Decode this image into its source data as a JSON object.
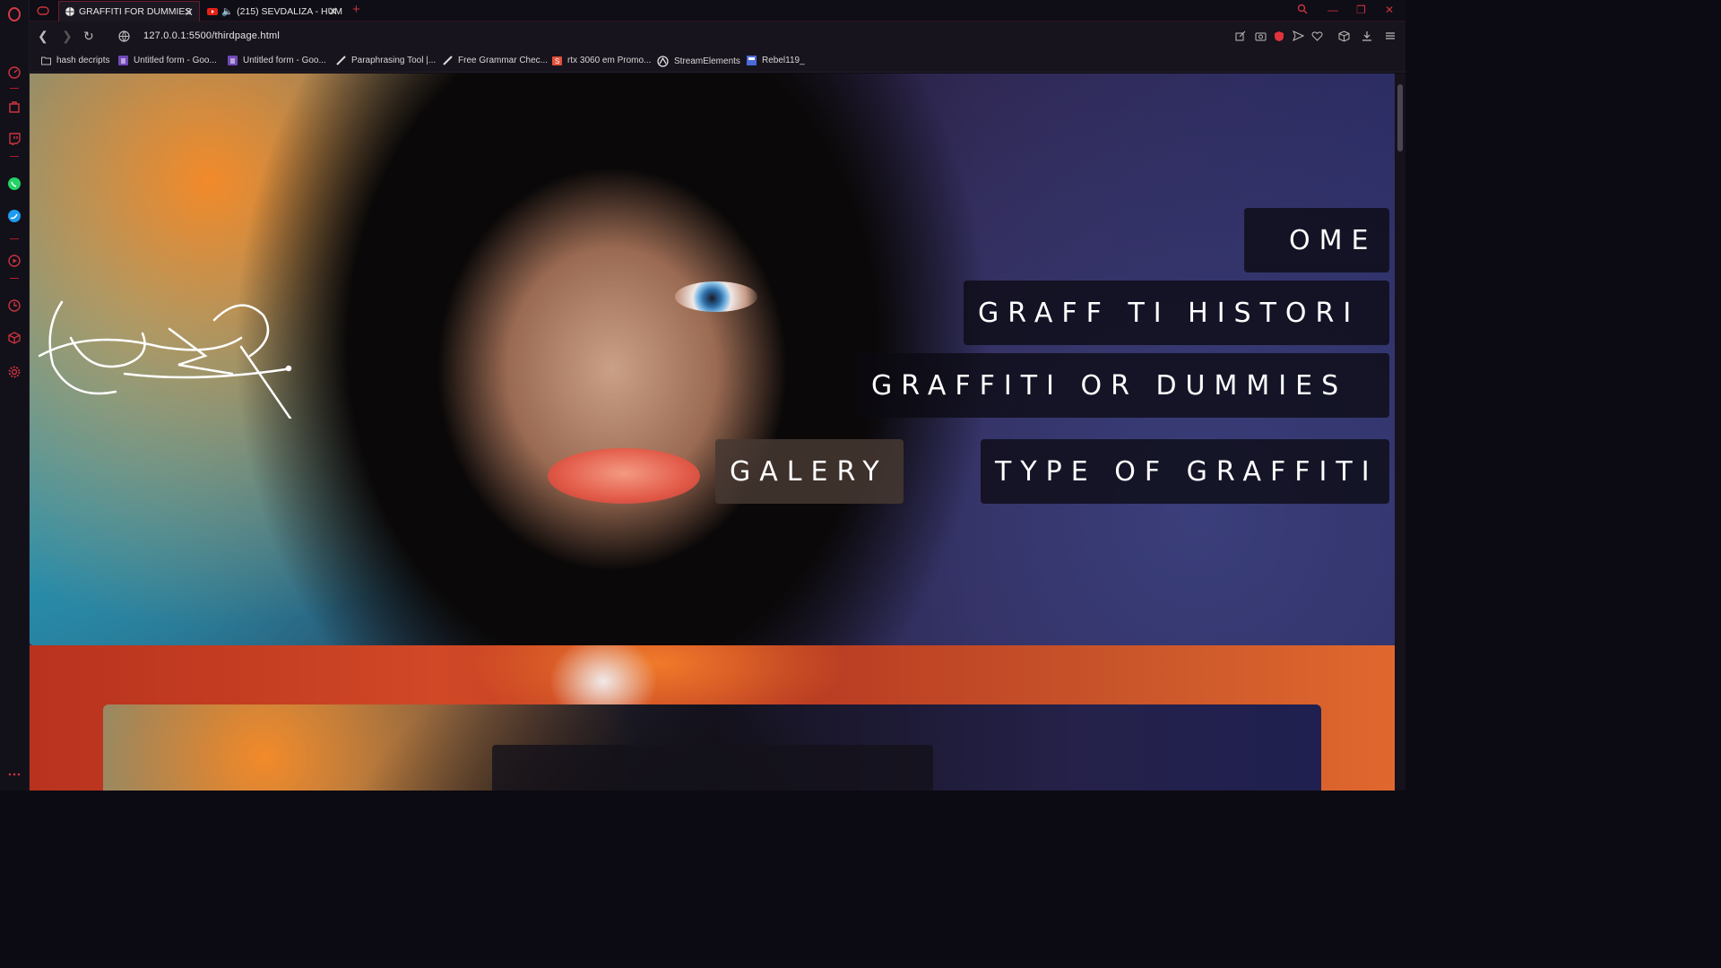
{
  "browser": {
    "tabs": [
      {
        "title": "GRAFFITI FOR DUMMIES",
        "active": true
      },
      {
        "title": "(215) SEVDALIZA - HUM",
        "active": false
      }
    ],
    "url": "127.0.0.1:5500/thirdpage.html",
    "accent": "#c9343f"
  },
  "bookmarks": [
    {
      "label": "hash decripts",
      "icon": "folder-icon"
    },
    {
      "label": "Untitled form - Goo...",
      "icon": "forms-icon"
    },
    {
      "label": "Untitled form - Goo...",
      "icon": "forms-icon"
    },
    {
      "label": "Paraphrasing Tool |...",
      "icon": "quill-icon"
    },
    {
      "label": "Free Grammar Chec...",
      "icon": "quill-icon"
    },
    {
      "label": "rtx 3060 em Promo...",
      "icon": "shop-icon"
    },
    {
      "label": "StreamElements",
      "icon": "streamelements-icon"
    },
    {
      "label": "Rebel119_",
      "icon": "page-icon"
    }
  ],
  "page": {
    "nav": {
      "home": "OME",
      "history": "GRAFF TI HISTORI",
      "dummies": "GRAFFITI  OR DUMMIES",
      "galery": "GALERY",
      "types": "TYPE OF GRAFFITI"
    }
  }
}
